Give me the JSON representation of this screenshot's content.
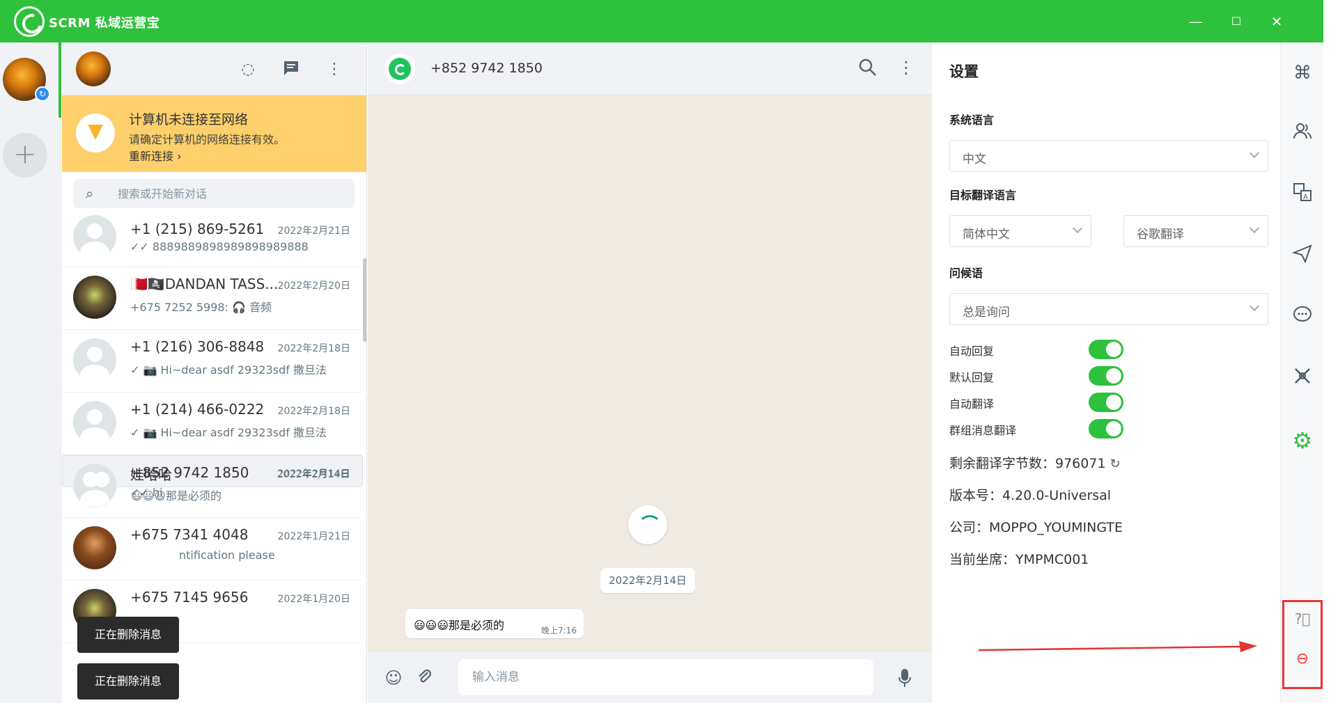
{
  "window": {
    "title": "SCRM 私域运营宝",
    "minimize": "—",
    "maximize": "☐",
    "close": "✕"
  },
  "rail": {
    "add": "+"
  },
  "list_header": {
    "icons": [
      "refresh-icon",
      "chat-icon",
      "menu-icon"
    ]
  },
  "banner": {
    "title": "计算机未连接至网络",
    "subtitle": "请确定计算机的网络连接有效。",
    "action": "重新连接 ›"
  },
  "search": {
    "placeholder": "搜索或开始新对话"
  },
  "chats": [
    {
      "name": "+1 (215) 869-5261",
      "date": "2022年2月21日",
      "msg": "✓✓ 8889889898989898989888"
    },
    {
      "name": "🇧🇭🏴‍☠️DANDAN TASS...",
      "date": "2022年2月20日",
      "msg": "+675 7252 5998: 🎧 音频"
    },
    {
      "name": "+1 (216) 306-8848",
      "date": "2022年2月18日",
      "msg": "✓ 📷 Hi~dear asdf 29323sdf 撒旦法"
    },
    {
      "name": "+1 (214) 466-0222",
      "date": "2022年2月18日",
      "msg": "✓ 📷 Hi~dear asdf 29323sdf 撒旦法"
    },
    {
      "name": "+852 9742 1850",
      "date": "2022年2月14日",
      "msg": "😃😃😃那是必须的"
    },
    {
      "name": "娃哈哈",
      "date": "2022年2月14日",
      "msg": "✓✓ hi"
    },
    {
      "name": "+675 7341 4048",
      "date": "2022年1月21日",
      "msg": "ntification please"
    },
    {
      "name": "+675 7145 9656",
      "date": "2022年1月20日",
      "msg": ""
    }
  ],
  "toasts": [
    "正在删除消息",
    "正在删除消息"
  ],
  "conversation": {
    "title": "+852 9742 1850",
    "date_chip": "2022年2月14日",
    "message": {
      "text": "😃😃😃那是必须的",
      "time": "晚上7:16"
    },
    "input_placeholder": "输入消息"
  },
  "settings": {
    "title": "设置",
    "system_language_label": "系统语言",
    "system_language_value": "中文",
    "target_language_label": "目标翻译语言",
    "target_language_value": "简体中文",
    "translator_value": "谷歌翻译",
    "greeting_label": "问候语",
    "greeting_value": "总是询问",
    "toggles": [
      {
        "label": "自动回复",
        "on": true
      },
      {
        "label": "默认回复",
        "on": true
      },
      {
        "label": "自动翻译",
        "on": true
      },
      {
        "label": "群组消息翻译",
        "on": true
      }
    ],
    "remaining_label": "剩余翻译字节数：976071",
    "version": "版本号：4.20.0-Universal",
    "company": "公司：MOPPO_YOUMINGTE",
    "seat": "当前坐席：YMPMC001"
  },
  "colors": {
    "brand_green": "#2ec13b",
    "banner_yellow": "#fdd06b",
    "highlight_red": "#e33333"
  }
}
